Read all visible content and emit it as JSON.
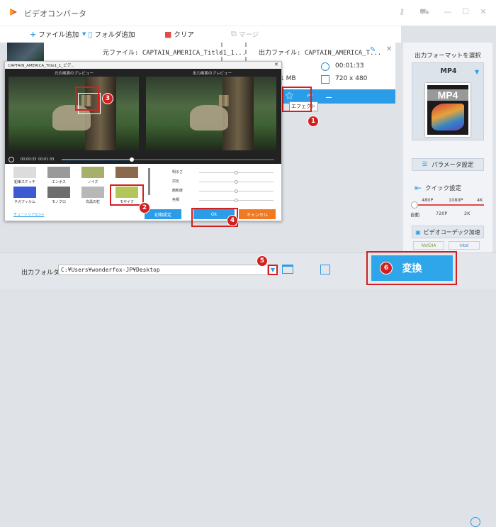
{
  "app": {
    "title": "ビデオコンバータ"
  },
  "toolbar": {
    "add_file": "ファイル追加",
    "add_folder": "フォルダ追加",
    "clear": "クリア",
    "merge": "マージ"
  },
  "file": {
    "source": "元ファイル: CAPTAIN_AMERICA_Title1_1...",
    "output": "出力ファイル: CAPTAIN_AMERICA_T...",
    "size": "1 MB",
    "duration": "00:01:33",
    "resolution": "720 x 480",
    "effect_tooltip": "エフェクト"
  },
  "dialog": {
    "title": "CAPTAIN_AMERICA_Title1_1_ビデ...",
    "preview_original": "元の画面のプレビュー",
    "preview_output": "出力画面のプレビュー",
    "time_current": "00:00:33",
    "time_total": "00:01:33",
    "seek_progress": 0.33,
    "effects": [
      {
        "label": "鉛筆スケッチ",
        "color": "#dcdcdc"
      },
      {
        "label": "エンボス",
        "color": "#9a9a9a"
      },
      {
        "label": "ノイズ",
        "color": "#a7b06b"
      },
      {
        "label": "",
        "color": "#8a6a4a"
      },
      {
        "label": "ネガフィルム",
        "color": "#3d5bd1"
      },
      {
        "label": "モノクロ",
        "color": "#6d6d6d"
      },
      {
        "label": "白黒の粒",
        "color": "#b8b8b8"
      },
      {
        "label": "モザイク",
        "color": "#b4c65a"
      }
    ],
    "sliders": [
      {
        "label": "明るさ",
        "value": 0.5
      },
      {
        "label": "対比",
        "value": 0.5
      },
      {
        "label": "飽和度",
        "value": 0.5
      },
      {
        "label": "色相",
        "value": 0.5
      }
    ],
    "tutorial": "チュートリアル>>",
    "reset": "初期設定",
    "ok": "Ok",
    "cancel": "キャンセル"
  },
  "right_panel": {
    "title": "出力フォーマットを選択",
    "format": "MP4",
    "format_icon_label": "MP4",
    "params": "パラメータ設定",
    "quick": "クイック設定",
    "quick_top": [
      "480P",
      "1080P",
      "4K"
    ],
    "quick_bottom": [
      "自動",
      "720P",
      "2K"
    ],
    "hw_accel": "ビデオコーデック加速",
    "nvidia": "NVIDIA",
    "intel": "intel"
  },
  "bottom": {
    "output_label": "出力フォルダ：",
    "output_path": "C:¥Users¥wonderfox-JP¥Desktop",
    "convert": "変換"
  },
  "badges": [
    "1",
    "2",
    "3",
    "4",
    "5",
    "6"
  ],
  "colors": {
    "accent": "#2b9ce8",
    "highlight": "#d41f1f",
    "cancel": "#f17a21"
  }
}
